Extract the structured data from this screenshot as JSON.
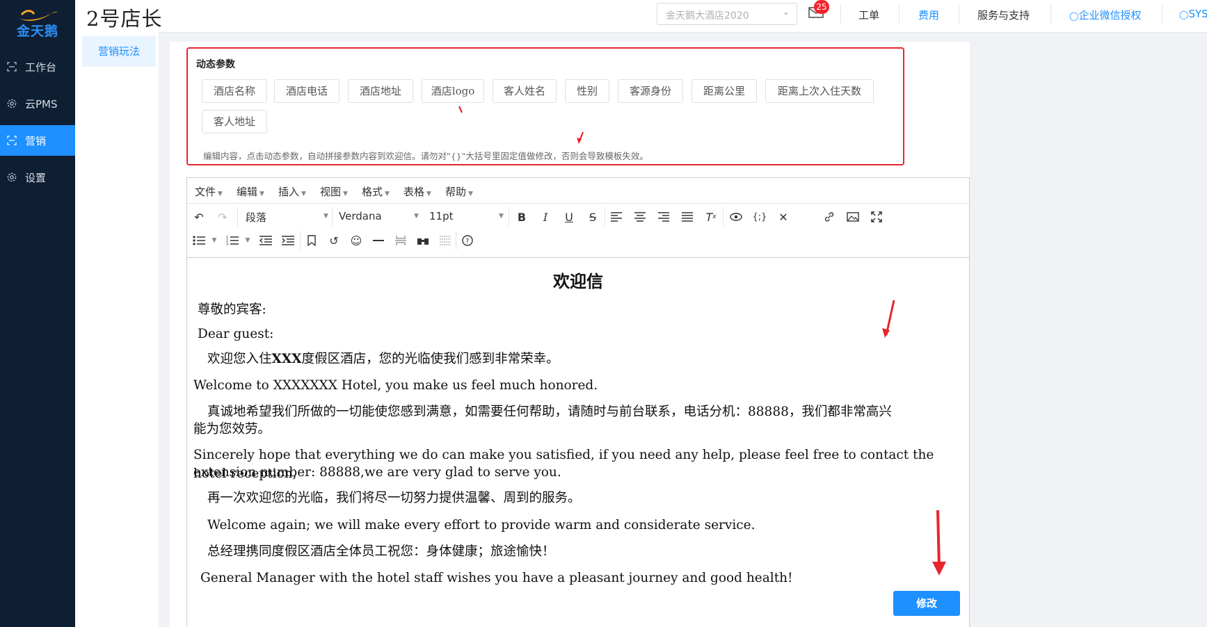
{
  "sidebar": {
    "logo_text": "金天鹅",
    "items": [
      {
        "label": "工作台",
        "icon": "workbench-icon"
      },
      {
        "label": "云PMS",
        "icon": "gear-icon"
      },
      {
        "label": "营销",
        "icon": "marketing-icon",
        "active": true
      },
      {
        "label": "设置",
        "icon": "settings-icon"
      }
    ]
  },
  "header": {
    "brand": "2号店长",
    "hotel_select": "金天鹅大酒店2020",
    "mail_badge": "25",
    "links": [
      "工单",
      "费用",
      "服务与支持",
      "企业微信授权",
      "SYS"
    ]
  },
  "subnav": {
    "selected": "营销玩法"
  },
  "params": {
    "title": "动态参数",
    "tags": [
      "酒店名称",
      "酒店电话",
      "酒店地址",
      "酒店logo",
      "客人姓名",
      "性别",
      "客源身份",
      "距离公里",
      "距离上次入住天数",
      "客人地址"
    ],
    "hint": "编辑内容，点击动态参数，自动拼接参数内容到欢迎信。请勿对\"{}\"大括号里固定值做修改，否则会导致模板失效。"
  },
  "editor": {
    "menus": [
      "文件",
      "编辑",
      "插入",
      "视图",
      "格式",
      "表格",
      "帮助"
    ],
    "block_format": "段落",
    "font_family": "Verdana",
    "font_size": "11pt",
    "doc_title": "欢迎信",
    "greeting_cn": "尊敬的宾客:",
    "greeting_en": "Dear guest:",
    "para1_cn_prefix": "欢迎您入住",
    "para1_cn_bold": "XXX",
    "para1_cn_suffix": "度假区酒店，您的光临使我们感到非常荣幸。",
    "para1_en": "Welcome to XXXXXXX Hotel, you make us feel much honored.",
    "para2_cn_line1": "真诚地希望我们所做的一切能使您感到满意，如需要任何帮助，请随时与前台联系，电话分机：88888，我们都非常高兴",
    "para2_cn_line2": "能为您效劳。",
    "para2_en_line1": "Sincerely hope that everything we do can make you satisfied, if you need any help, please feel free to contact the hotel reception,",
    "para2_en_line2": "extension number: 88888,we are very glad to serve you.",
    "para3_cn": "再一次欢迎您的光临，我们将尽一切努力提供温馨、周到的服务。",
    "para3_en": "Welcome again; we will make every effort to provide warm and considerate service.",
    "para4_cn": "总经理携同度假区酒店全体员工祝您：身体健康；旅途愉快！",
    "para4_en": "General Manager with the hotel staff wishes you have a pleasant journey and good health!"
  },
  "actions": {
    "save_label": "修改"
  },
  "colors": {
    "accent": "#1e90ff",
    "nav_bg": "#0f1f33",
    "annotation": "#e8252d"
  }
}
